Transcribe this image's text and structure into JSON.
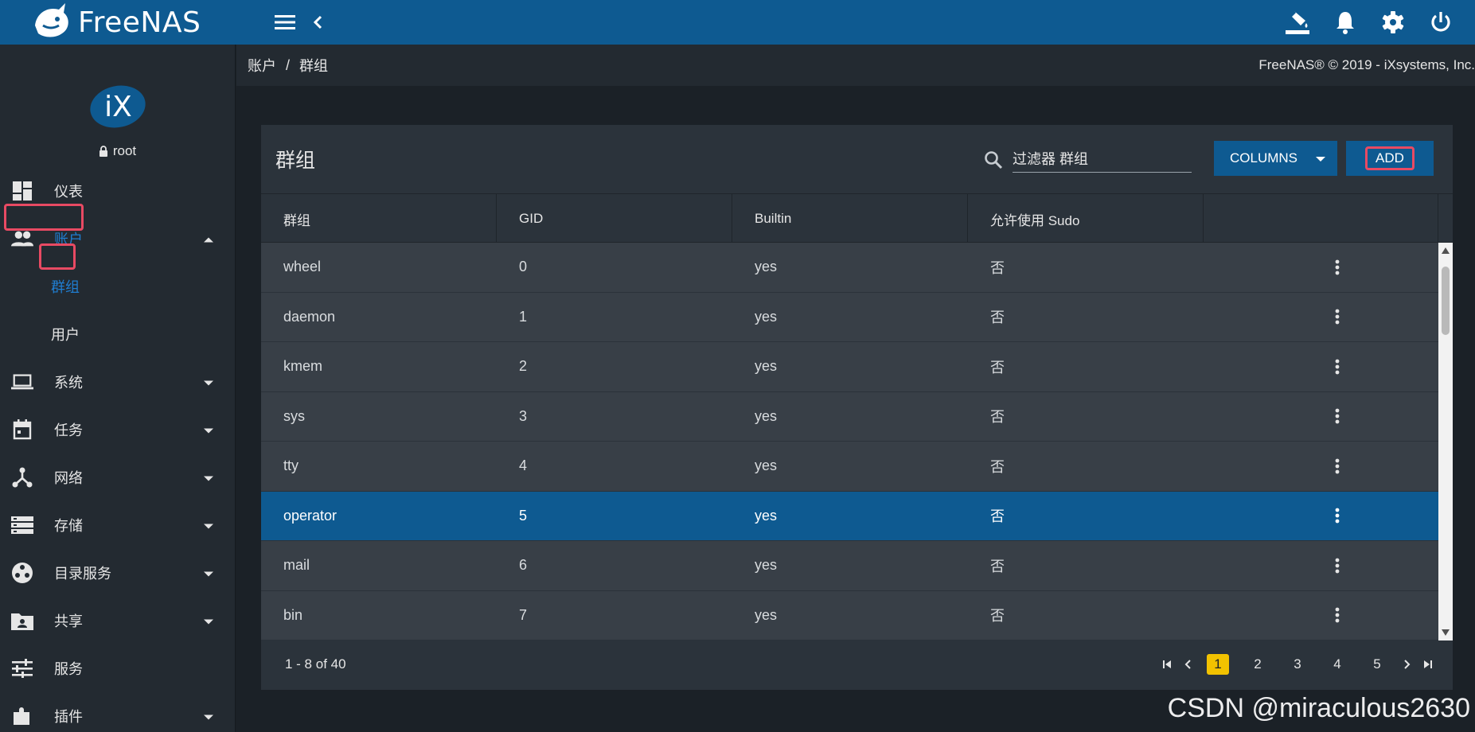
{
  "topbar": {
    "brand": "FreeNAS",
    "icons": [
      "menu-icon",
      "chevron-left-icon",
      "paint-bucket-icon",
      "bell-icon",
      "gear-icon",
      "power-icon"
    ]
  },
  "profile": {
    "logo": "iX",
    "user": "root"
  },
  "sidebar": {
    "items": [
      {
        "label": "仪表",
        "icon": "dashboard-icon"
      },
      {
        "label": "账户",
        "icon": "people-icon",
        "expanded": true
      },
      {
        "label": "系统",
        "icon": "laptop-icon"
      },
      {
        "label": "任务",
        "icon": "calendar-icon"
      },
      {
        "label": "网络",
        "icon": "network-icon"
      },
      {
        "label": "存储",
        "icon": "storage-icon"
      },
      {
        "label": "目录服务",
        "icon": "directory-icon"
      },
      {
        "label": "共享",
        "icon": "share-folder-icon"
      },
      {
        "label": "服务",
        "icon": "sliders-icon"
      },
      {
        "label": "插件",
        "icon": "plugin-icon"
      }
    ],
    "sub_items": [
      {
        "label": "群组",
        "active": true
      },
      {
        "label": "用户",
        "active": false
      }
    ]
  },
  "breadcrumb": {
    "parent": "账户",
    "separator": "/",
    "current": "群组"
  },
  "copyright": "FreeNAS® © 2019 - iXsystems, Inc.",
  "card": {
    "title": "群组",
    "filter_placeholder": "过滤器 群组",
    "columns_label": "COLUMNS",
    "add_label": "ADD"
  },
  "table": {
    "headers": [
      "群组",
      "GID",
      "Builtin",
      "允许使用 Sudo"
    ],
    "rows": [
      {
        "name": "wheel",
        "gid": "0",
        "builtin": "yes",
        "sudo": "否"
      },
      {
        "name": "daemon",
        "gid": "1",
        "builtin": "yes",
        "sudo": "否"
      },
      {
        "name": "kmem",
        "gid": "2",
        "builtin": "yes",
        "sudo": "否"
      },
      {
        "name": "sys",
        "gid": "3",
        "builtin": "yes",
        "sudo": "否"
      },
      {
        "name": "tty",
        "gid": "4",
        "builtin": "yes",
        "sudo": "否"
      },
      {
        "name": "operator",
        "gid": "5",
        "builtin": "yes",
        "sudo": "否",
        "selected": true
      },
      {
        "name": "mail",
        "gid": "6",
        "builtin": "yes",
        "sudo": "否"
      },
      {
        "name": "bin",
        "gid": "7",
        "builtin": "yes",
        "sudo": "否"
      }
    ]
  },
  "pagination": {
    "range": "1 - 8 of 40",
    "pages": [
      "1",
      "2",
      "3",
      "4",
      "5"
    ],
    "current": "1"
  },
  "watermark": "CSDN @miraculous2630",
  "colors": {
    "topbar": "#0e5a91",
    "sidebar": "#232a31",
    "card": "#2b333b",
    "row": "#383f47",
    "selected_row": "#0e5a91",
    "highlight_box": "#e84a63",
    "active_nav": "#1f7dd0",
    "current_page": "#f2c200"
  }
}
